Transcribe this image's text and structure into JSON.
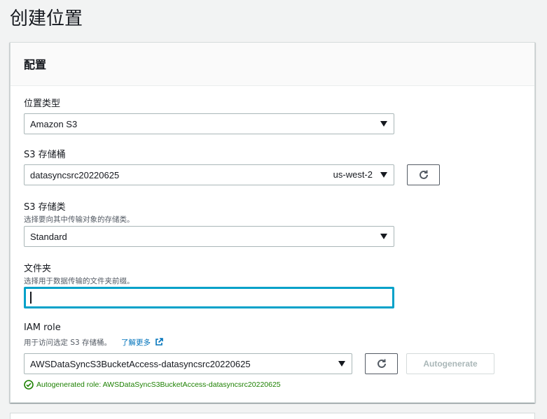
{
  "page": {
    "title": "创建位置"
  },
  "panel": {
    "title": "配置"
  },
  "location_type": {
    "label": "位置类型",
    "value": "Amazon S3"
  },
  "s3_bucket": {
    "label": "S3 存储桶",
    "value": "datasyncsrc20220625",
    "region": "us-west-2"
  },
  "s3_storage_class": {
    "label": "S3 存储类",
    "description": "选择要向其中传输对象的存储类。",
    "value": "Standard"
  },
  "folder": {
    "label": "文件夹",
    "description": "选择用于数据传输的文件夹前缀。",
    "value": ""
  },
  "iam_role": {
    "label": "IAM role",
    "description": "用于访问选定 S3 存储桶。",
    "learn_more": "了解更多",
    "value": "AWSDataSyncS3BucketAccess-datasyncsrc20220625",
    "autogenerate_label": "Autogenerate",
    "status_text": "Autogenerated role: AWSDataSyncS3BucketAccess-datasyncsrc20220625"
  },
  "icons": {
    "caret": "caret-down-icon",
    "refresh": "refresh-icon",
    "external": "external-link-icon",
    "success": "success-check-icon"
  },
  "colors": {
    "link": "#0073bb",
    "focus": "#00a1c9",
    "success": "#1d8102"
  }
}
